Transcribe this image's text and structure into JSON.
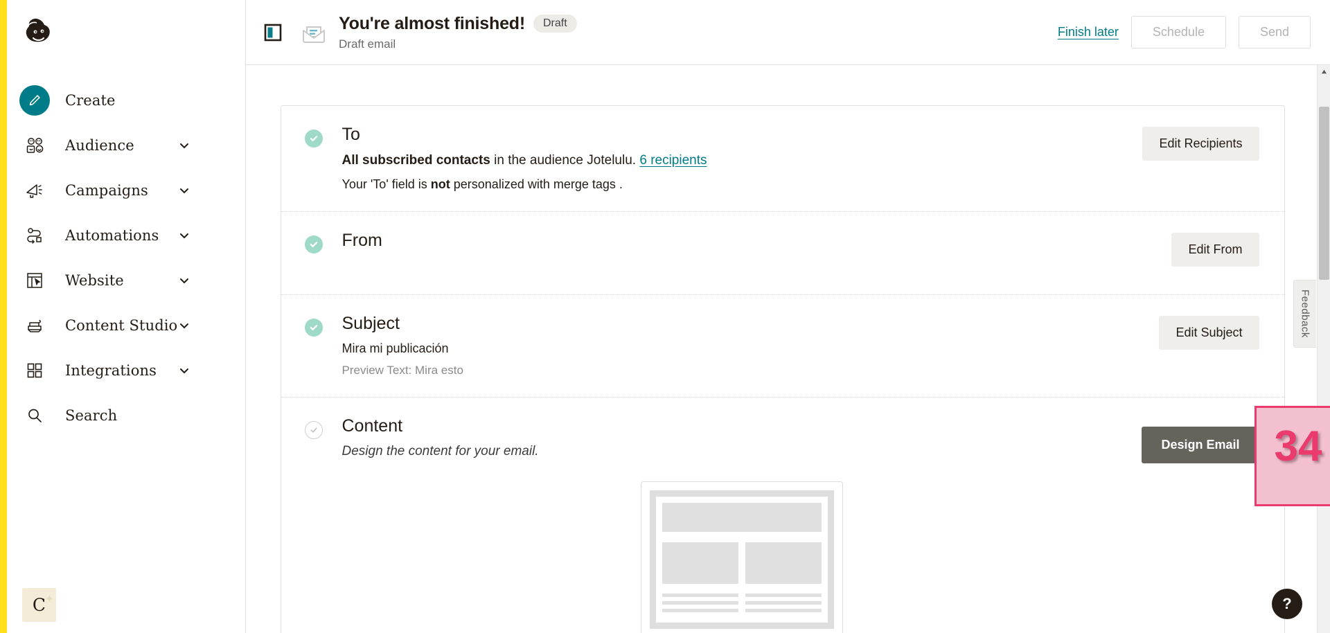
{
  "sidebar": {
    "logo": "mailchimp-freddie-logo",
    "items": [
      {
        "label": "Create",
        "icon": "pencil-icon",
        "chevron": false,
        "active": true
      },
      {
        "label": "Audience",
        "icon": "people-icon",
        "chevron": true,
        "active": false
      },
      {
        "label": "Campaigns",
        "icon": "megaphone-icon",
        "chevron": true,
        "active": false
      },
      {
        "label": "Automations",
        "icon": "automation-icon",
        "chevron": true,
        "active": false
      },
      {
        "label": "Website",
        "icon": "website-icon",
        "chevron": true,
        "active": false
      },
      {
        "label": "Content Studio",
        "icon": "content-studio-icon",
        "chevron": true,
        "active": false
      },
      {
        "label": "Integrations",
        "icon": "grid-icon",
        "chevron": true,
        "active": false
      },
      {
        "label": "Search",
        "icon": "search-icon",
        "chevron": false,
        "active": false
      }
    ],
    "avatar": {
      "letter": "C"
    }
  },
  "header": {
    "panel_toggle_icon": "panel-toggle-icon",
    "envelope_icon": "open-envelope-icon",
    "title": "You're almost finished!",
    "badge": "Draft",
    "subtitle": "Draft email",
    "finish_later": "Finish later",
    "schedule": "Schedule",
    "send": "Send"
  },
  "sections": [
    {
      "id": "to",
      "status": "done",
      "title": "To",
      "line_bold": "All subscribed contacts",
      "line_mid": " in the audience Jotelulu. ",
      "line_link": "6 recipients",
      "note_pre": "Your 'To' field is ",
      "note_bold": "not",
      "note_post": " personalized with merge tags .",
      "action": "Edit Recipients"
    },
    {
      "id": "from",
      "status": "done",
      "title": "From",
      "action": "Edit From"
    },
    {
      "id": "subject",
      "status": "done",
      "title": "Subject",
      "subject_value": "Mira mi publicación",
      "preview_text": "Preview Text: Mira esto",
      "action": "Edit Subject"
    },
    {
      "id": "content",
      "status": "todo",
      "title": "Content",
      "description": "Design the content for your email.",
      "action": "Design Email"
    }
  ],
  "feedback": {
    "label": "Feedback"
  },
  "help": {
    "label": "?"
  },
  "scrollbar": {
    "up_arrow_icon": "scroll-up-arrow-icon"
  },
  "annotation": {
    "number": "34",
    "target": "design-email-button"
  },
  "colors": {
    "brand_yellow": "#FFE01B",
    "teal": "#007c89",
    "check_green": "#9fd9c7",
    "annotation_pink": "#ea3a6e",
    "annotation_fill": "#f2c0ce",
    "design_button": "#66625c"
  }
}
